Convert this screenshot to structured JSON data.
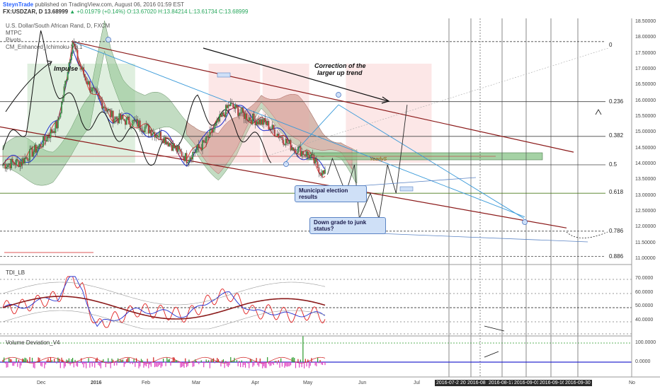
{
  "header": {
    "brand": "SteynTrade",
    "published": "published on TradingView.com, August 06, 2016 01:59 EST",
    "symbol_line": "FX:USDZAR, D 13.68999",
    "change": "▲ +0.01979 (+0.14%)",
    "ohlc": "O:13.67020 H:13.84214 L:13.61734 C:13.68999"
  },
  "symbol_info": {
    "name": "U.S. Dollar/South African Rand, D, FXCM",
    "studies": [
      "MTPC",
      "Pivots",
      "CM_Enhanced_Ichimoku-V3.1"
    ]
  },
  "annotations": {
    "impulse": "Impulse",
    "correction_1": "Correction of the",
    "correction_2": "larger up trend",
    "yearly": "YearlyS",
    "municipal_1": "Municipal election",
    "municipal_2": "results",
    "downgrade_1": "Down grade to junk",
    "downgrade_2": "status?"
  },
  "fib_labels": [
    "0",
    "0.236",
    "0.382",
    "0.5",
    "0.618",
    "0.786",
    "0.886"
  ],
  "price_axis": [
    "18.50000",
    "18.00000",
    "17.50000",
    "17.00000",
    "16.50000",
    "16.00000",
    "15.50000",
    "15.00000",
    "14.50000",
    "14.00000",
    "13.50000",
    "13.00000",
    "12.50000",
    "12.00000",
    "11.50000",
    "11.00000"
  ],
  "tdi_axis": [
    "70.0000",
    "60.0000",
    "50.0000",
    "40.0000"
  ],
  "vol_axis": [
    "100.0000",
    "0.0000"
  ],
  "indicators": {
    "tdi": "TDI_LB",
    "vol": "Volume Deviation_V4"
  },
  "x_months": [
    "Dec",
    "2016",
    "Feb",
    "Mar",
    "Apr",
    "May",
    "Jun",
    "Jul",
    "No"
  ],
  "x_dates": [
    "2016-07-2",
    "20",
    "2016-08",
    "2016-08-17",
    "2016-09-01",
    "2016-09-16",
    "2016-09-30"
  ],
  "colors": {
    "bull": "#3aa64a",
    "bear": "#d23b3b",
    "channel": "#8b1a1a",
    "tenkan": "#1f2fd0",
    "kijun": "#111111",
    "cloud_bull": "#8fbf8f",
    "cloud_bear": "#e5a4a4",
    "tdi_red": "#e02020",
    "tdi_blue": "#1f2fd0",
    "tdi_brown": "#8b1a1a",
    "projection": "#2a2a2a"
  },
  "chart_data": [
    {
      "type": "candlestick",
      "title": "U.S. Dollar/South African Rand, D, FXCM",
      "ylim": [
        11.0,
        18.5
      ],
      "x_range": [
        "2015-11-15",
        "2016-11-01"
      ],
      "key_points": [
        {
          "x": "2016-01-11",
          "y": 17.9
        },
        {
          "x": "2016-05-20",
          "y": 15.9
        },
        {
          "x": "2016-08-05",
          "y": 13.69
        }
      ],
      "fib_levels": [
        {
          "label": "0",
          "y": 17.9
        },
        {
          "label": "0.236",
          "y": 16.0
        },
        {
          "label": "0.382",
          "y": 14.9
        },
        {
          "label": "0.5",
          "y": 14.0
        },
        {
          "label": "0.618",
          "y": 13.1
        },
        {
          "label": "0.786",
          "y": 11.9
        },
        {
          "label": "0.886",
          "y": 11.1
        }
      ],
      "projection": [
        {
          "x": "2016-08-06",
          "y": 13.69
        },
        {
          "x": "2016-08-10",
          "y": 14.2
        },
        {
          "x": "2016-08-21",
          "y": 13.1
        },
        {
          "x": "2016-08-28",
          "y": 14.0
        },
        {
          "x": "2016-09-01",
          "y": 12.3
        },
        {
          "x": "2016-09-10",
          "y": 13.1
        },
        {
          "x": "2016-09-17",
          "y": 12.3
        },
        {
          "x": "2016-09-24",
          "y": 14.0
        },
        {
          "x": "2016-10-01",
          "y": 13.1
        },
        {
          "x": "2016-10-10",
          "y": 15.9
        }
      ],
      "ohlc": []
    },
    {
      "type": "line",
      "title": "TDI_LB",
      "ylim": [
        35,
        75
      ],
      "series": []
    },
    {
      "type": "bar",
      "title": "Volume Deviation_V4",
      "ylim": [
        -30,
        120
      ],
      "values": []
    }
  ]
}
